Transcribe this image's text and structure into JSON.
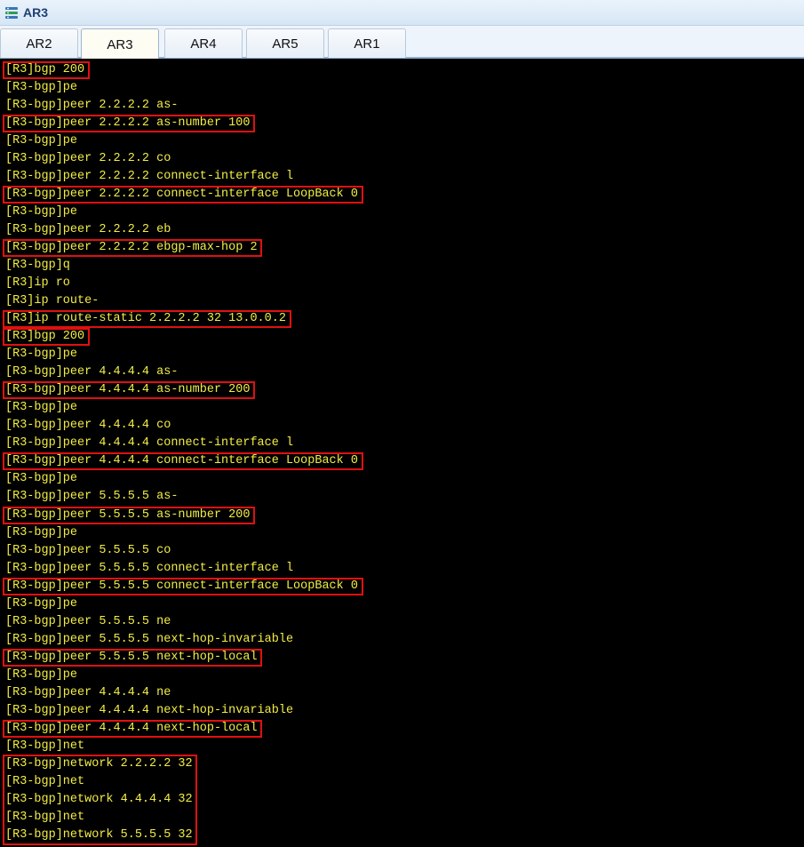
{
  "window": {
    "title": "AR3"
  },
  "tabs": [
    {
      "label": "AR2",
      "active": false
    },
    {
      "label": "AR3",
      "active": true
    },
    {
      "label": "AR4",
      "active": false
    },
    {
      "label": "AR5",
      "active": false
    },
    {
      "label": "AR1",
      "active": false
    }
  ],
  "colors": {
    "terminal_text": "#f2ed45",
    "terminal_bg": "#000000",
    "highlight_box": "#e01010"
  },
  "terminal": {
    "lines": [
      {
        "text": "[R3]bgp 200",
        "highlighted": true
      },
      {
        "text": "[R3-bgp]pe",
        "highlighted": false
      },
      {
        "text": "[R3-bgp]peer 2.2.2.2 as-",
        "highlighted": false
      },
      {
        "text": "[R3-bgp]peer 2.2.2.2 as-number 100",
        "highlighted": true
      },
      {
        "text": "[R3-bgp]pe",
        "highlighted": false
      },
      {
        "text": "[R3-bgp]peer 2.2.2.2 co",
        "highlighted": false
      },
      {
        "text": "[R3-bgp]peer 2.2.2.2 connect-interface l",
        "highlighted": false
      },
      {
        "text": "[R3-bgp]peer 2.2.2.2 connect-interface LoopBack 0",
        "highlighted": true
      },
      {
        "text": "[R3-bgp]pe",
        "highlighted": false
      },
      {
        "text": "[R3-bgp]peer 2.2.2.2 eb",
        "highlighted": false
      },
      {
        "text": "[R3-bgp]peer 2.2.2.2 ebgp-max-hop 2",
        "highlighted": true
      },
      {
        "text": "[R3-bgp]q",
        "highlighted": false
      },
      {
        "text": "[R3]ip ro",
        "highlighted": false
      },
      {
        "text": "[R3]ip route-",
        "highlighted": false
      },
      {
        "text": "[R3]ip route-static 2.2.2.2 32 13.0.0.2",
        "highlighted": true
      },
      {
        "text": "[R3]bgp 200",
        "highlighted": true
      },
      {
        "text": "[R3-bgp]pe",
        "highlighted": false
      },
      {
        "text": "[R3-bgp]peer 4.4.4.4 as-",
        "highlighted": false
      },
      {
        "text": "[R3-bgp]peer 4.4.4.4 as-number 200",
        "highlighted": true
      },
      {
        "text": "[R3-bgp]pe",
        "highlighted": false
      },
      {
        "text": "[R3-bgp]peer 4.4.4.4 co",
        "highlighted": false
      },
      {
        "text": "[R3-bgp]peer 4.4.4.4 connect-interface l",
        "highlighted": false
      },
      {
        "text": "[R3-bgp]peer 4.4.4.4 connect-interface LoopBack 0",
        "highlighted": true
      },
      {
        "text": "[R3-bgp]pe",
        "highlighted": false
      },
      {
        "text": "[R3-bgp]peer 5.5.5.5 as-",
        "highlighted": false
      },
      {
        "text": "[R3-bgp]peer 5.5.5.5 as-number 200",
        "highlighted": true
      },
      {
        "text": "[R3-bgp]pe",
        "highlighted": false
      },
      {
        "text": "[R3-bgp]peer 5.5.5.5 co",
        "highlighted": false
      },
      {
        "text": "[R3-bgp]peer 5.5.5.5 connect-interface l",
        "highlighted": false
      },
      {
        "text": "[R3-bgp]peer 5.5.5.5 connect-interface LoopBack 0",
        "highlighted": true
      },
      {
        "text": "[R3-bgp]pe",
        "highlighted": false
      },
      {
        "text": "[R3-bgp]peer 5.5.5.5 ne",
        "highlighted": false
      },
      {
        "text": "[R3-bgp]peer 5.5.5.5 next-hop-invariable",
        "highlighted": false
      },
      {
        "text": "[R3-bgp]peer 5.5.5.5 next-hop-local",
        "highlighted": true
      },
      {
        "text": "[R3-bgp]pe",
        "highlighted": false
      },
      {
        "text": "[R3-bgp]peer 4.4.4.4 ne",
        "highlighted": false
      },
      {
        "text": "[R3-bgp]peer 4.4.4.4 next-hop-invariable",
        "highlighted": false
      },
      {
        "text": "[R3-bgp]peer 4.4.4.4 next-hop-local",
        "highlighted": true
      },
      {
        "text": "[R3-bgp]net",
        "highlighted": false
      },
      {
        "text": "[R3-bgp]network 2.2.2.2 32",
        "highlighted": false
      },
      {
        "text": "[R3-bgp]net",
        "highlighted": false
      },
      {
        "text": "[R3-bgp]network 4.4.4.4 32",
        "highlighted": false
      },
      {
        "text": "[R3-bgp]net",
        "highlighted": false
      },
      {
        "text": "[R3-bgp]network 5.5.5.5 32",
        "highlighted": false
      }
    ]
  }
}
